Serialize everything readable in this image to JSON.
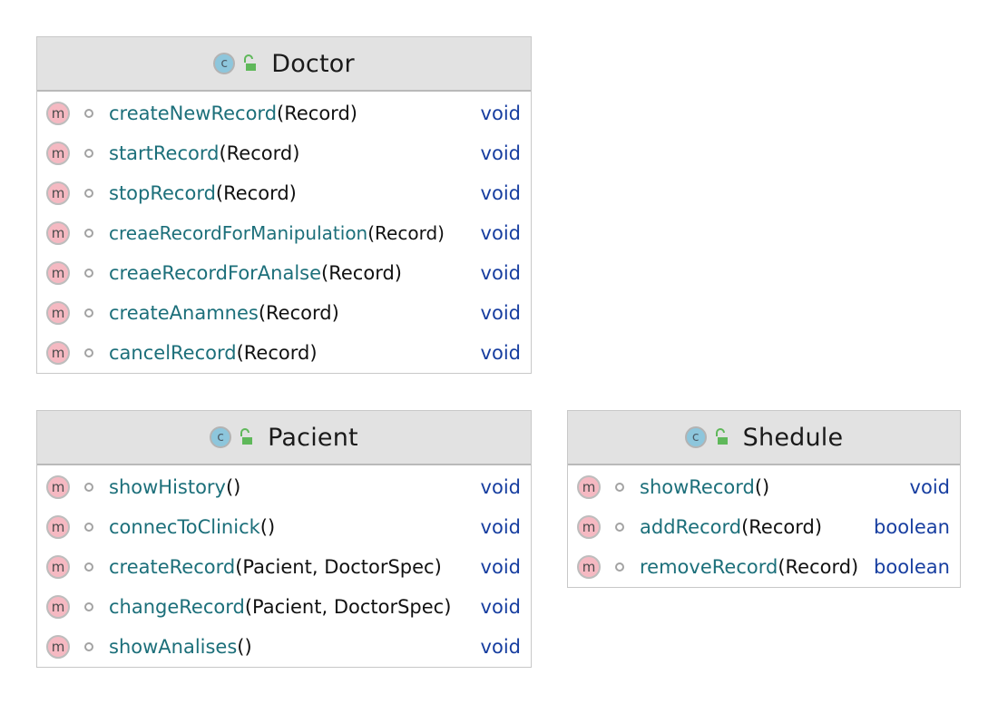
{
  "classes": {
    "doctor": {
      "name": "Doctor",
      "methods": [
        {
          "name": "createNewRecord",
          "params": "(Record)",
          "returns": "void"
        },
        {
          "name": "startRecord",
          "params": "(Record)",
          "returns": "void"
        },
        {
          "name": "stopRecord",
          "params": "(Record)",
          "returns": "void"
        },
        {
          "name": "creaeRecordForManipulation",
          "params": "(Record)",
          "returns": "void"
        },
        {
          "name": "creaeRecordForAnalse",
          "params": "(Record)",
          "returns": "void"
        },
        {
          "name": "createAnamnes",
          "params": "(Record)",
          "returns": "void"
        },
        {
          "name": "cancelRecord",
          "params": "(Record)",
          "returns": "void"
        }
      ]
    },
    "pacient": {
      "name": "Pacient",
      "methods": [
        {
          "name": "showHistory",
          "params": "()",
          "returns": "void"
        },
        {
          "name": "connecToClinick",
          "params": "()",
          "returns": "void"
        },
        {
          "name": "createRecord",
          "params": "(Pacient, DoctorSpec)",
          "returns": "void"
        },
        {
          "name": "changeRecord",
          "params": "(Pacient, DoctorSpec)",
          "returns": "void"
        },
        {
          "name": "showAnalises",
          "params": "()",
          "returns": "void"
        }
      ]
    },
    "shedule": {
      "name": "Shedule",
      "methods": [
        {
          "name": "showRecord",
          "params": "()",
          "returns": "void"
        },
        {
          "name": "addRecord",
          "params": "(Record)",
          "returns": "boolean"
        },
        {
          "name": "removeRecord",
          "params": "(Record)",
          "returns": "boolean"
        }
      ]
    }
  },
  "icons": {
    "class_icon_letter": "c",
    "method_icon_letter": "m",
    "class_icon_color": "#8dc6dc",
    "method_icon_color": "#f5b9c2",
    "lock_icon_color": "#5fb85a"
  },
  "colors": {
    "method_name": "#1c6f7a",
    "return_type": "#173ea0",
    "header_background": "#e2e2e2"
  }
}
